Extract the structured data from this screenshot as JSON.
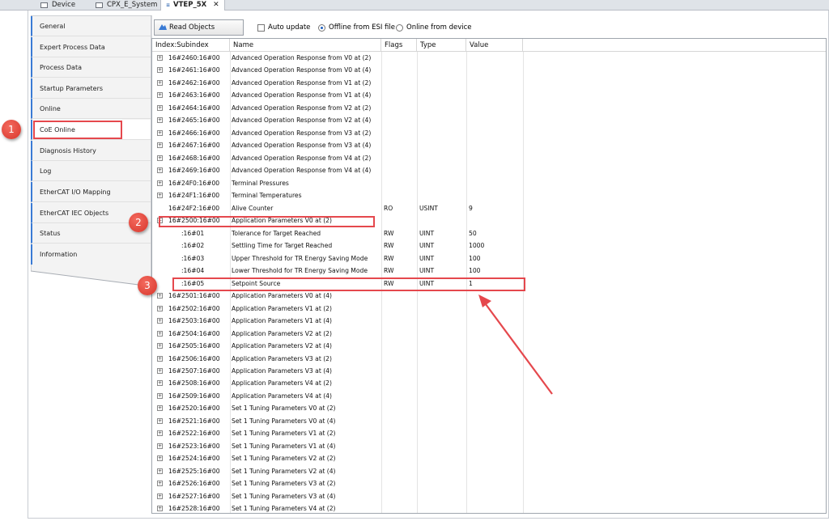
{
  "tabs": [
    {
      "label": "Device"
    },
    {
      "label": "CPX_E_System"
    },
    {
      "label": "VTEP_5X",
      "close": "✕"
    }
  ],
  "sidebar": {
    "items": [
      {
        "label": "General"
      },
      {
        "label": "Expert Process Data"
      },
      {
        "label": "Process Data"
      },
      {
        "label": "Startup Parameters"
      },
      {
        "label": "Online"
      },
      {
        "label": "CoE Online"
      },
      {
        "label": "Diagnosis History"
      },
      {
        "label": "Log"
      },
      {
        "label": "EtherCAT I/O Mapping"
      },
      {
        "label": "EtherCAT IEC Objects"
      },
      {
        "label": "Status"
      },
      {
        "label": "Information"
      }
    ]
  },
  "toolbar": {
    "read_objects": "Read Objects",
    "auto_update": "Auto update",
    "offline_esi": "Offline from ESI file",
    "online_device": "Online from device"
  },
  "table": {
    "columns": [
      "Index:Subindex",
      "Name",
      "Flags",
      "Type",
      "Value"
    ],
    "rows": [
      {
        "index": "16#2460:16#00",
        "name": "Advanced Operation Response from V0 at (2)",
        "flags": "",
        "type": "",
        "value": "",
        "expandable": true
      },
      {
        "index": "16#2461:16#00",
        "name": "Advanced Operation Response from V0 at (4)",
        "flags": "",
        "type": "",
        "value": "",
        "expandable": true
      },
      {
        "index": "16#2462:16#00",
        "name": "Advanced Operation Response from V1 at (2)",
        "flags": "",
        "type": "",
        "value": "",
        "expandable": true
      },
      {
        "index": "16#2463:16#00",
        "name": "Advanced Operation Response from V1 at (4)",
        "flags": "",
        "type": "",
        "value": "",
        "expandable": true
      },
      {
        "index": "16#2464:16#00",
        "name": "Advanced Operation Response from V2 at (2)",
        "flags": "",
        "type": "",
        "value": "",
        "expandable": true
      },
      {
        "index": "16#2465:16#00",
        "name": "Advanced Operation Response from V2 at (4)",
        "flags": "",
        "type": "",
        "value": "",
        "expandable": true
      },
      {
        "index": "16#2466:16#00",
        "name": "Advanced Operation Response from V3 at (2)",
        "flags": "",
        "type": "",
        "value": "",
        "expandable": true
      },
      {
        "index": "16#2467:16#00",
        "name": "Advanced Operation Response from V3 at (4)",
        "flags": "",
        "type": "",
        "value": "",
        "expandable": true
      },
      {
        "index": "16#2468:16#00",
        "name": "Advanced Operation Response from V4 at (2)",
        "flags": "",
        "type": "",
        "value": "",
        "expandable": true
      },
      {
        "index": "16#2469:16#00",
        "name": "Advanced Operation Response from V4 at (4)",
        "flags": "",
        "type": "",
        "value": "",
        "expandable": true
      },
      {
        "index": "16#24F0:16#00",
        "name": "Terminal Pressures",
        "flags": "",
        "type": "",
        "value": "",
        "expandable": true
      },
      {
        "index": "16#24F1:16#00",
        "name": "Terminal Temperatures",
        "flags": "",
        "type": "",
        "value": "",
        "expandable": true
      },
      {
        "index": "16#24F2:16#00",
        "name": "Alive Counter",
        "flags": "RO",
        "type": "USINT",
        "value": "9",
        "expandable": false
      },
      {
        "index": "16#2500:16#00",
        "name": "Application Parameters V0 at (2)",
        "flags": "",
        "type": "",
        "value": "",
        "expandable": true,
        "expanded": true
      },
      {
        "index": ":16#01",
        "name": "Tolerance for Target Reached",
        "flags": "RW",
        "type": "UINT",
        "value": "50",
        "child": true
      },
      {
        "index": ":16#02",
        "name": "Settling Time for Target Reached",
        "flags": "RW",
        "type": "UINT",
        "value": "1000",
        "child": true
      },
      {
        "index": ":16#03",
        "name": "Upper Threshold for TR Energy Saving Mode",
        "flags": "RW",
        "type": "UINT",
        "value": "100",
        "child": true
      },
      {
        "index": ":16#04",
        "name": "Lower Threshold for TR Energy Saving Mode",
        "flags": "RW",
        "type": "UINT",
        "value": "100",
        "child": true
      },
      {
        "index": ":16#05",
        "name": "Setpoint Source",
        "flags": "RW",
        "type": "UINT",
        "value": "1",
        "child": true
      },
      {
        "index": "16#2501:16#00",
        "name": "Application Parameters V0 at (4)",
        "flags": "",
        "type": "",
        "value": "",
        "expandable": true
      },
      {
        "index": "16#2502:16#00",
        "name": "Application Parameters V1 at (2)",
        "flags": "",
        "type": "",
        "value": "",
        "expandable": true
      },
      {
        "index": "16#2503:16#00",
        "name": "Application Parameters V1 at (4)",
        "flags": "",
        "type": "",
        "value": "",
        "expandable": true
      },
      {
        "index": "16#2504:16#00",
        "name": "Application Parameters V2 at (2)",
        "flags": "",
        "type": "",
        "value": "",
        "expandable": true
      },
      {
        "index": "16#2505:16#00",
        "name": "Application Parameters V2 at (4)",
        "flags": "",
        "type": "",
        "value": "",
        "expandable": true
      },
      {
        "index": "16#2506:16#00",
        "name": "Application Parameters V3 at (2)",
        "flags": "",
        "type": "",
        "value": "",
        "expandable": true
      },
      {
        "index": "16#2507:16#00",
        "name": "Application Parameters V3 at (4)",
        "flags": "",
        "type": "",
        "value": "",
        "expandable": true
      },
      {
        "index": "16#2508:16#00",
        "name": "Application Parameters V4 at (2)",
        "flags": "",
        "type": "",
        "value": "",
        "expandable": true
      },
      {
        "index": "16#2509:16#00",
        "name": "Application Parameters V4 at (4)",
        "flags": "",
        "type": "",
        "value": "",
        "expandable": true
      },
      {
        "index": "16#2520:16#00",
        "name": "Set 1 Tuning Parameters V0 at (2)",
        "flags": "",
        "type": "",
        "value": "",
        "expandable": true
      },
      {
        "index": "16#2521:16#00",
        "name": "Set 1 Tuning Parameters V0 at (4)",
        "flags": "",
        "type": "",
        "value": "",
        "expandable": true
      },
      {
        "index": "16#2522:16#00",
        "name": "Set 1 Tuning Parameters V1 at (2)",
        "flags": "",
        "type": "",
        "value": "",
        "expandable": true
      },
      {
        "index": "16#2523:16#00",
        "name": "Set 1 Tuning Parameters V1 at (4)",
        "flags": "",
        "type": "",
        "value": "",
        "expandable": true
      },
      {
        "index": "16#2524:16#00",
        "name": "Set 1 Tuning Parameters V2 at (2)",
        "flags": "",
        "type": "",
        "value": "",
        "expandable": true
      },
      {
        "index": "16#2525:16#00",
        "name": "Set 1 Tuning Parameters V2 at (4)",
        "flags": "",
        "type": "",
        "value": "",
        "expandable": true
      },
      {
        "index": "16#2526:16#00",
        "name": "Set 1 Tuning Parameters V3 at (2)",
        "flags": "",
        "type": "",
        "value": "",
        "expandable": true
      },
      {
        "index": "16#2527:16#00",
        "name": "Set 1 Tuning Parameters V3 at (4)",
        "flags": "",
        "type": "",
        "value": "",
        "expandable": true
      },
      {
        "index": "16#2528:16#00",
        "name": "Set 1 Tuning Parameters V4 at (2)",
        "flags": "",
        "type": "",
        "value": "",
        "expandable": true
      }
    ]
  },
  "annotations": {
    "badges": [
      "1",
      "2",
      "3"
    ],
    "color": "#e5484d"
  }
}
